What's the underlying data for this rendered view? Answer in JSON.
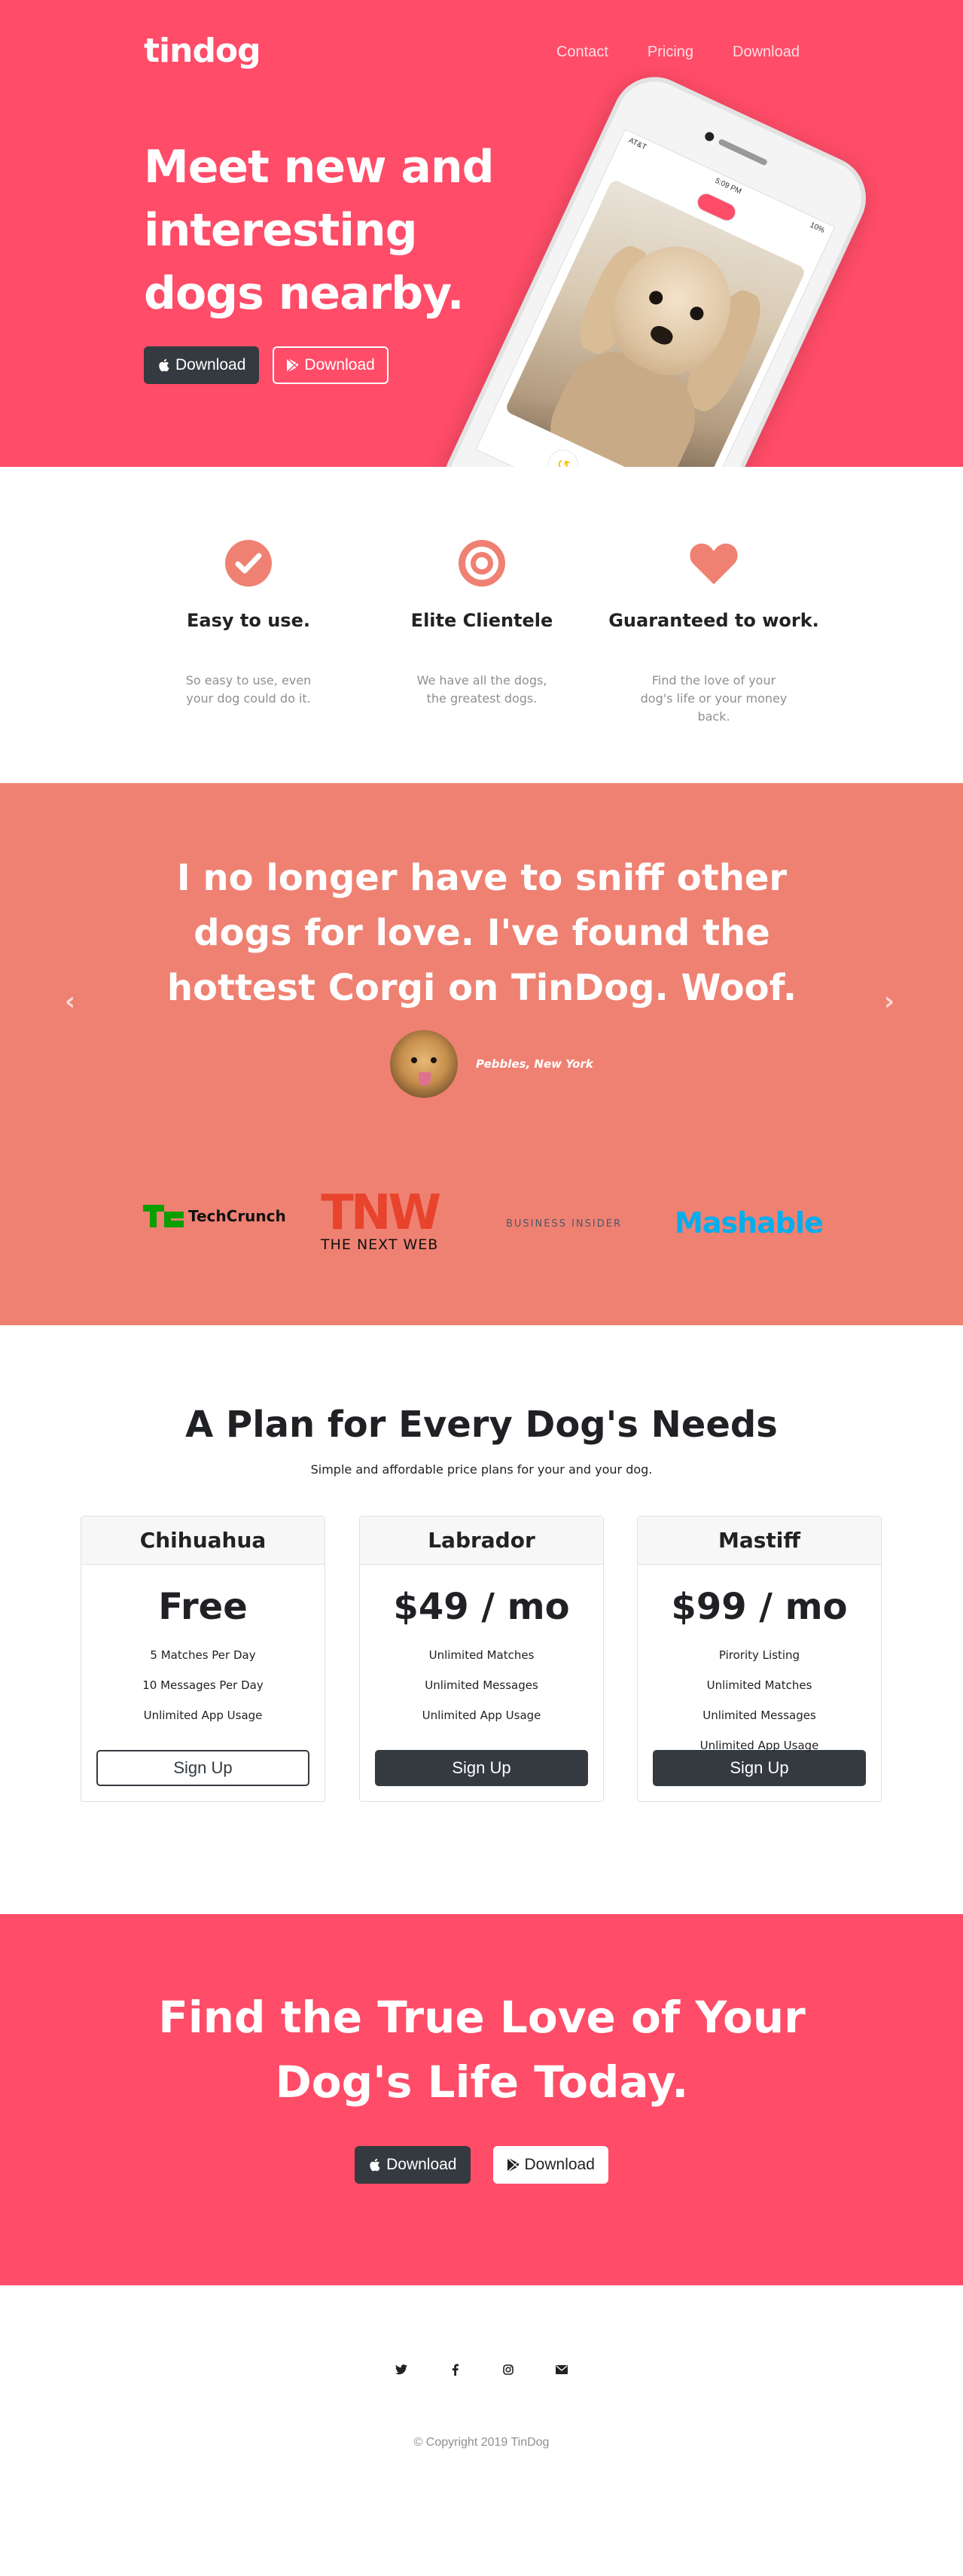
{
  "nav": {
    "brand": "tindog",
    "links": [
      "Contact",
      "Pricing",
      "Download"
    ]
  },
  "hero": {
    "title": "Meet new and interesting dogs nearby.",
    "apple_button": "Download",
    "play_button": "Download",
    "phone": {
      "carrier": "AT&T",
      "time": "5:09 PM",
      "battery": "10%"
    }
  },
  "features": [
    {
      "icon": "check-circle-icon",
      "title": "Easy to use.",
      "text": "So easy to use, even your dog could do it."
    },
    {
      "icon": "bullseye-icon",
      "title": "Elite Clientele",
      "text": "We have all the dogs, the greatest dogs."
    },
    {
      "icon": "heart-icon",
      "title": "Guaranteed to work.",
      "text": "Find the love of your dog's life or your money back."
    }
  ],
  "testimonial": {
    "quote": "I no longer have to sniff other dogs for love. I've found the hottest Corgi on TinDog. Woof.",
    "author": "Pebbles, New York"
  },
  "press": {
    "techcrunch": "TechCrunch",
    "tnw_mark": "TNW",
    "tnw_sub": "THE NEXT WEB",
    "business_insider": "BUSINESS INSIDER",
    "mashable": "Mashable"
  },
  "pricing": {
    "title": "A Plan for Every Dog's Needs",
    "subtitle": "Simple and affordable price plans for your and your dog.",
    "plans": [
      {
        "name": "Chihuahua",
        "price": "Free",
        "features": [
          "5 Matches Per Day",
          "10 Messages Per Day",
          "Unlimited App Usage"
        ],
        "button": "Sign Up"
      },
      {
        "name": "Labrador",
        "price": "$49 / mo",
        "features": [
          "Unlimited Matches",
          "Unlimited Messages",
          "Unlimited App Usage"
        ],
        "button": "Sign Up"
      },
      {
        "name": "Mastiff",
        "price": "$99 / mo",
        "features": [
          "Pirority Listing",
          "Unlimited Matches",
          "Unlimited Messages",
          "Unlimited App Usage"
        ],
        "button": "Sign Up"
      }
    ]
  },
  "cta": {
    "title": "Find the True Love of Your Dog's Life Today.",
    "apple_button": "Download",
    "play_button": "Download"
  },
  "footer": {
    "socials": [
      "twitter-icon",
      "facebook-icon",
      "instagram-icon",
      "envelope-icon"
    ],
    "copyright": "© Copyright 2019 TinDog"
  },
  "colors": {
    "primary": "#ff4c68",
    "testimonial_bg": "#ef8172",
    "feature_icon": "#ef8172",
    "dark": "#343a40"
  }
}
